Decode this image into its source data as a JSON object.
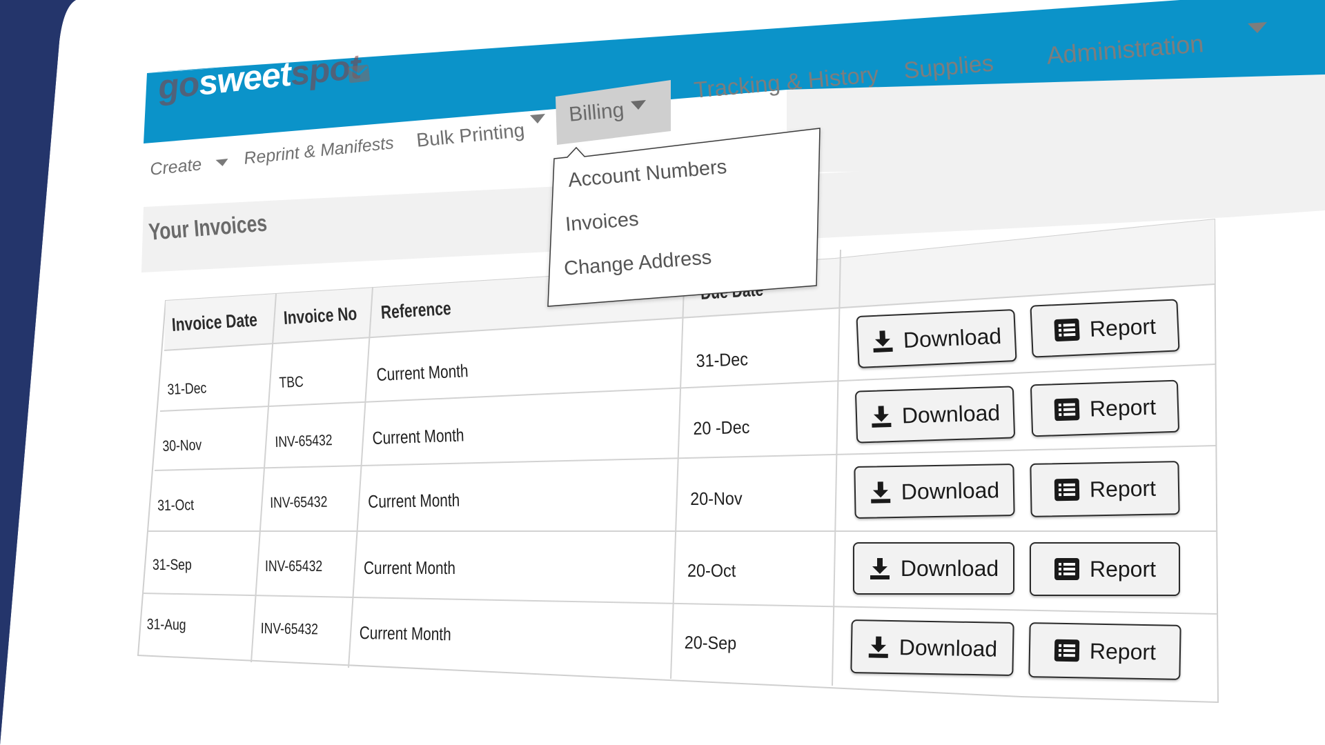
{
  "brand": {
    "logo_go": "go",
    "logo_sweet": "sweet",
    "logo_spot": "spot",
    "color_blue": "#0b93c9",
    "color_navy": "#24356b"
  },
  "top_nav": {
    "tracking": "Tracking & History",
    "supplies": "Supplies",
    "administration": "Administration"
  },
  "sub_nav": {
    "create": "Create",
    "reprint": "Reprint & Manifests",
    "bulk": "Bulk Printing",
    "billing": "Billing"
  },
  "billing_menu": {
    "items": [
      "Account Numbers",
      "Invoices",
      "Change Address"
    ]
  },
  "page": {
    "title": "Your Invoices"
  },
  "table": {
    "headers": {
      "invoice_date": "Invoice Date",
      "invoice_no": "Invoice No",
      "reference": "Reference",
      "due_date": "Due Date"
    },
    "rows": [
      {
        "date": "31-Dec",
        "no": "TBC",
        "ref": "Current Month",
        "due": "31-Dec"
      },
      {
        "date": "30-Nov",
        "no": "INV-65432",
        "ref": "Current Month",
        "due": "20 -Dec"
      },
      {
        "date": "31-Oct",
        "no": "INV-65432",
        "ref": "Current Month",
        "due": "20-Nov"
      },
      {
        "date": "31-Sep",
        "no": "INV-65432",
        "ref": "Current Month",
        "due": "20-Oct"
      },
      {
        "date": "31-Aug",
        "no": "INV-65432",
        "ref": "Current Month",
        "due": "20-Sep"
      }
    ],
    "download_label": "Download",
    "report_label": "Report"
  }
}
